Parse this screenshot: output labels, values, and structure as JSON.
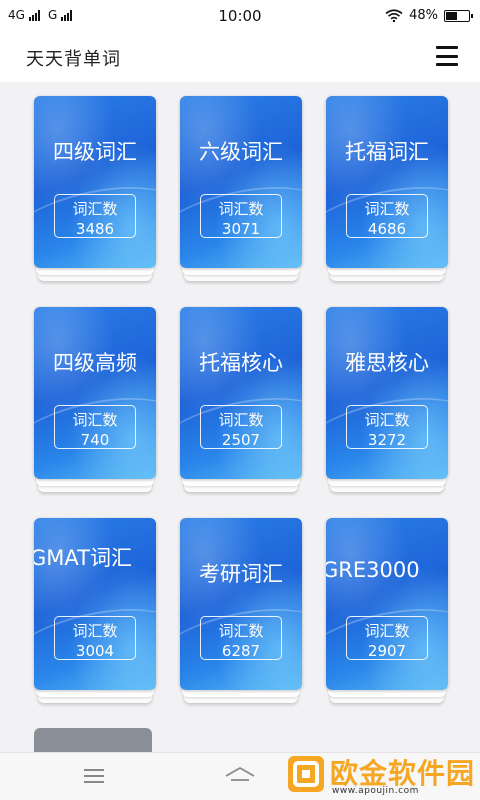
{
  "status_bar": {
    "network_left": "4G",
    "network_right": "G",
    "time": "10:00",
    "battery_text": "48%",
    "battery_level": 0.48
  },
  "app_bar": {
    "title": "天天背单词",
    "menu_icon": "hamburger-menu-icon"
  },
  "books": [
    {
      "name": "四级词汇",
      "count_label": "词汇数",
      "count": "3486"
    },
    {
      "name": "六级词汇",
      "count_label": "词汇数",
      "count": "3071"
    },
    {
      "name": "托福词汇",
      "count_label": "词汇数",
      "count": "4686"
    },
    {
      "name": "四级高频",
      "count_label": "词汇数",
      "count": "740"
    },
    {
      "name": "托福核心",
      "count_label": "词汇数",
      "count": "2507"
    },
    {
      "name": "雅思核心",
      "count_label": "词汇数",
      "count": "3272"
    },
    {
      "name": "GMAT词汇",
      "count_label": "词汇数",
      "count": "3004"
    },
    {
      "name": "考研词汇",
      "count_label": "词汇数",
      "count": "6287"
    },
    {
      "name": "GRE3000",
      "count_label": "词汇数",
      "count": "2907"
    }
  ],
  "bottom_nav": {
    "menu_icon": "menu-icon",
    "home_icon": "home-icon"
  },
  "watermark": {
    "text": "欧金软件园",
    "url": "www.apoujin.com"
  },
  "colors": {
    "cover_blue": "#1d63d8",
    "cover_light": "#5ab8f4",
    "watermark_orange": "#f5a623"
  }
}
